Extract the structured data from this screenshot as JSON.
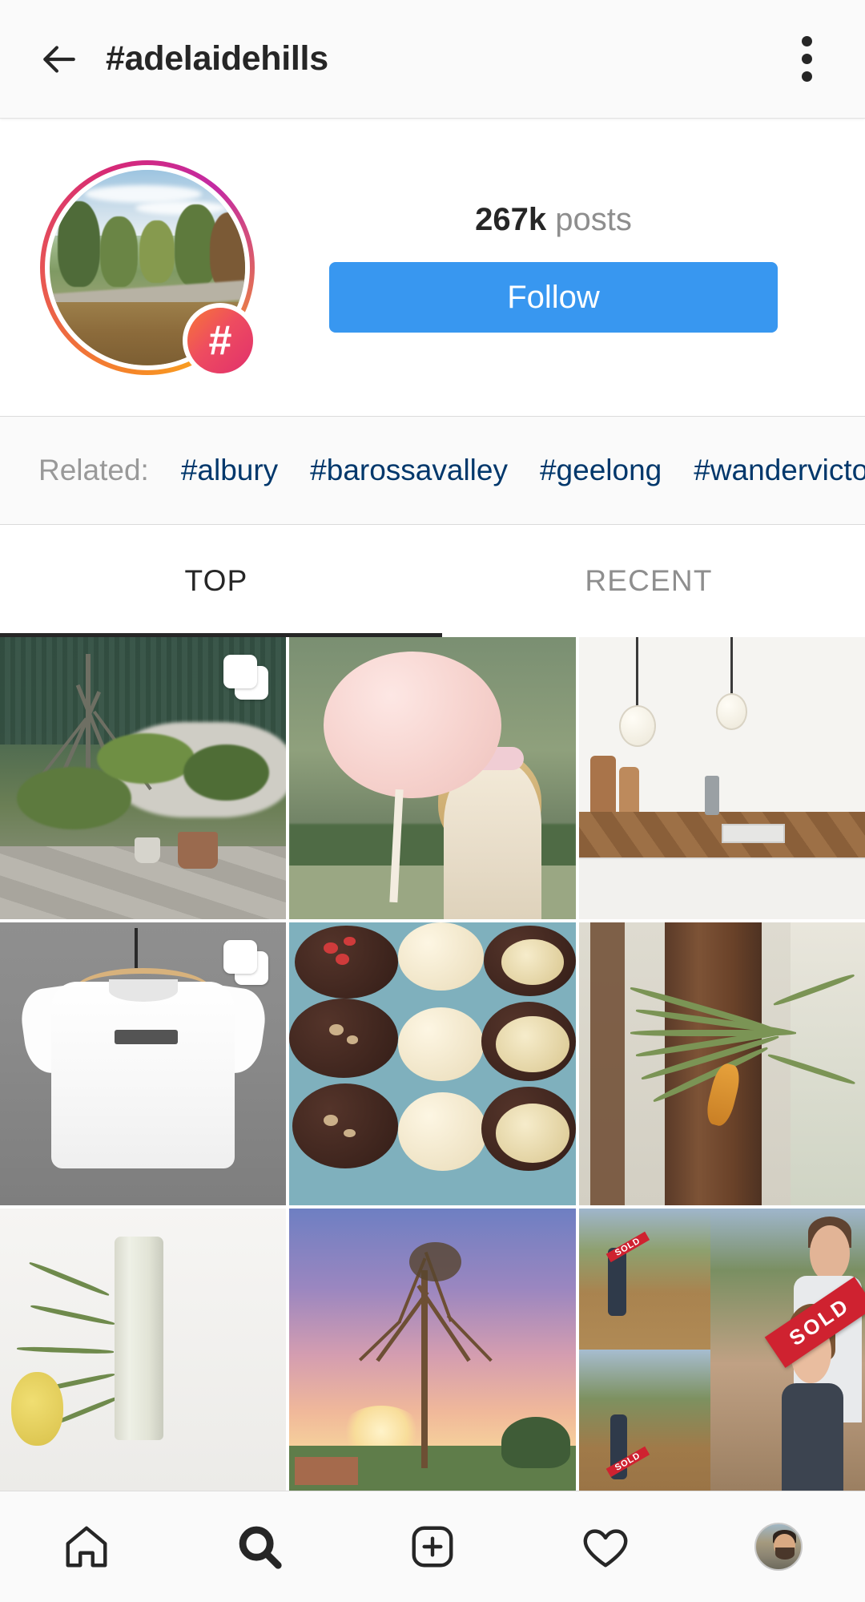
{
  "header": {
    "title": "#adelaidehills",
    "back_icon": "back-arrow-icon",
    "menu_icon": "more-options-icon"
  },
  "profile": {
    "avatar_icon": "hashtag-avatar",
    "badge_symbol": "#",
    "posts_count": "267k",
    "posts_label": "posts",
    "follow_label": "Follow",
    "follow_color": "#3897f0"
  },
  "related": {
    "label": "Related:",
    "label_color": "#999999",
    "link_color": "#00376b",
    "tags": [
      "#albury",
      "#barossavalley",
      "#geelong",
      "#wandervictoria"
    ]
  },
  "tabs": [
    {
      "label": "TOP",
      "active": true
    },
    {
      "label": "RECENT",
      "active": false
    }
  ],
  "grid": {
    "posts": [
      {
        "name": "post-garden-tree",
        "multi": true,
        "alt": "Garden with bare tree, gravel and pavers"
      },
      {
        "name": "post-pink-balloon",
        "multi": false,
        "alt": "Woman holding large pink balloon"
      },
      {
        "name": "post-kitchen",
        "multi": false,
        "alt": "Modern kitchen with pendant bulbs and timber bench"
      },
      {
        "name": "post-white-tshirt",
        "multi": true,
        "alt": "White t-shirt on wooden hanger"
      },
      {
        "name": "post-chocolate-cakes",
        "multi": false,
        "alt": "Chocolate cupcakes with cream topping"
      },
      {
        "name": "post-banksia-branch",
        "multi": false,
        "alt": "Banksia branch against tree trunk"
      },
      {
        "name": "post-ceramic-vase",
        "multi": false,
        "alt": "Ceramic vase with banksia flower"
      },
      {
        "name": "post-sunset-tree",
        "multi": false,
        "alt": "Bare tree at sunset"
      },
      {
        "name": "post-sold-sign",
        "multi": false,
        "alt": "Couple with SOLD sign collage",
        "sold_text": "SOLD"
      }
    ]
  },
  "bottom_nav": [
    {
      "name": "nav-home",
      "icon": "home-icon",
      "active": false
    },
    {
      "name": "nav-search",
      "icon": "search-icon",
      "active": true
    },
    {
      "name": "nav-add",
      "icon": "add-post-icon",
      "active": false
    },
    {
      "name": "nav-activity",
      "icon": "heart-icon",
      "active": false
    },
    {
      "name": "nav-profile",
      "icon": "avatar-icon",
      "active": false
    }
  ]
}
